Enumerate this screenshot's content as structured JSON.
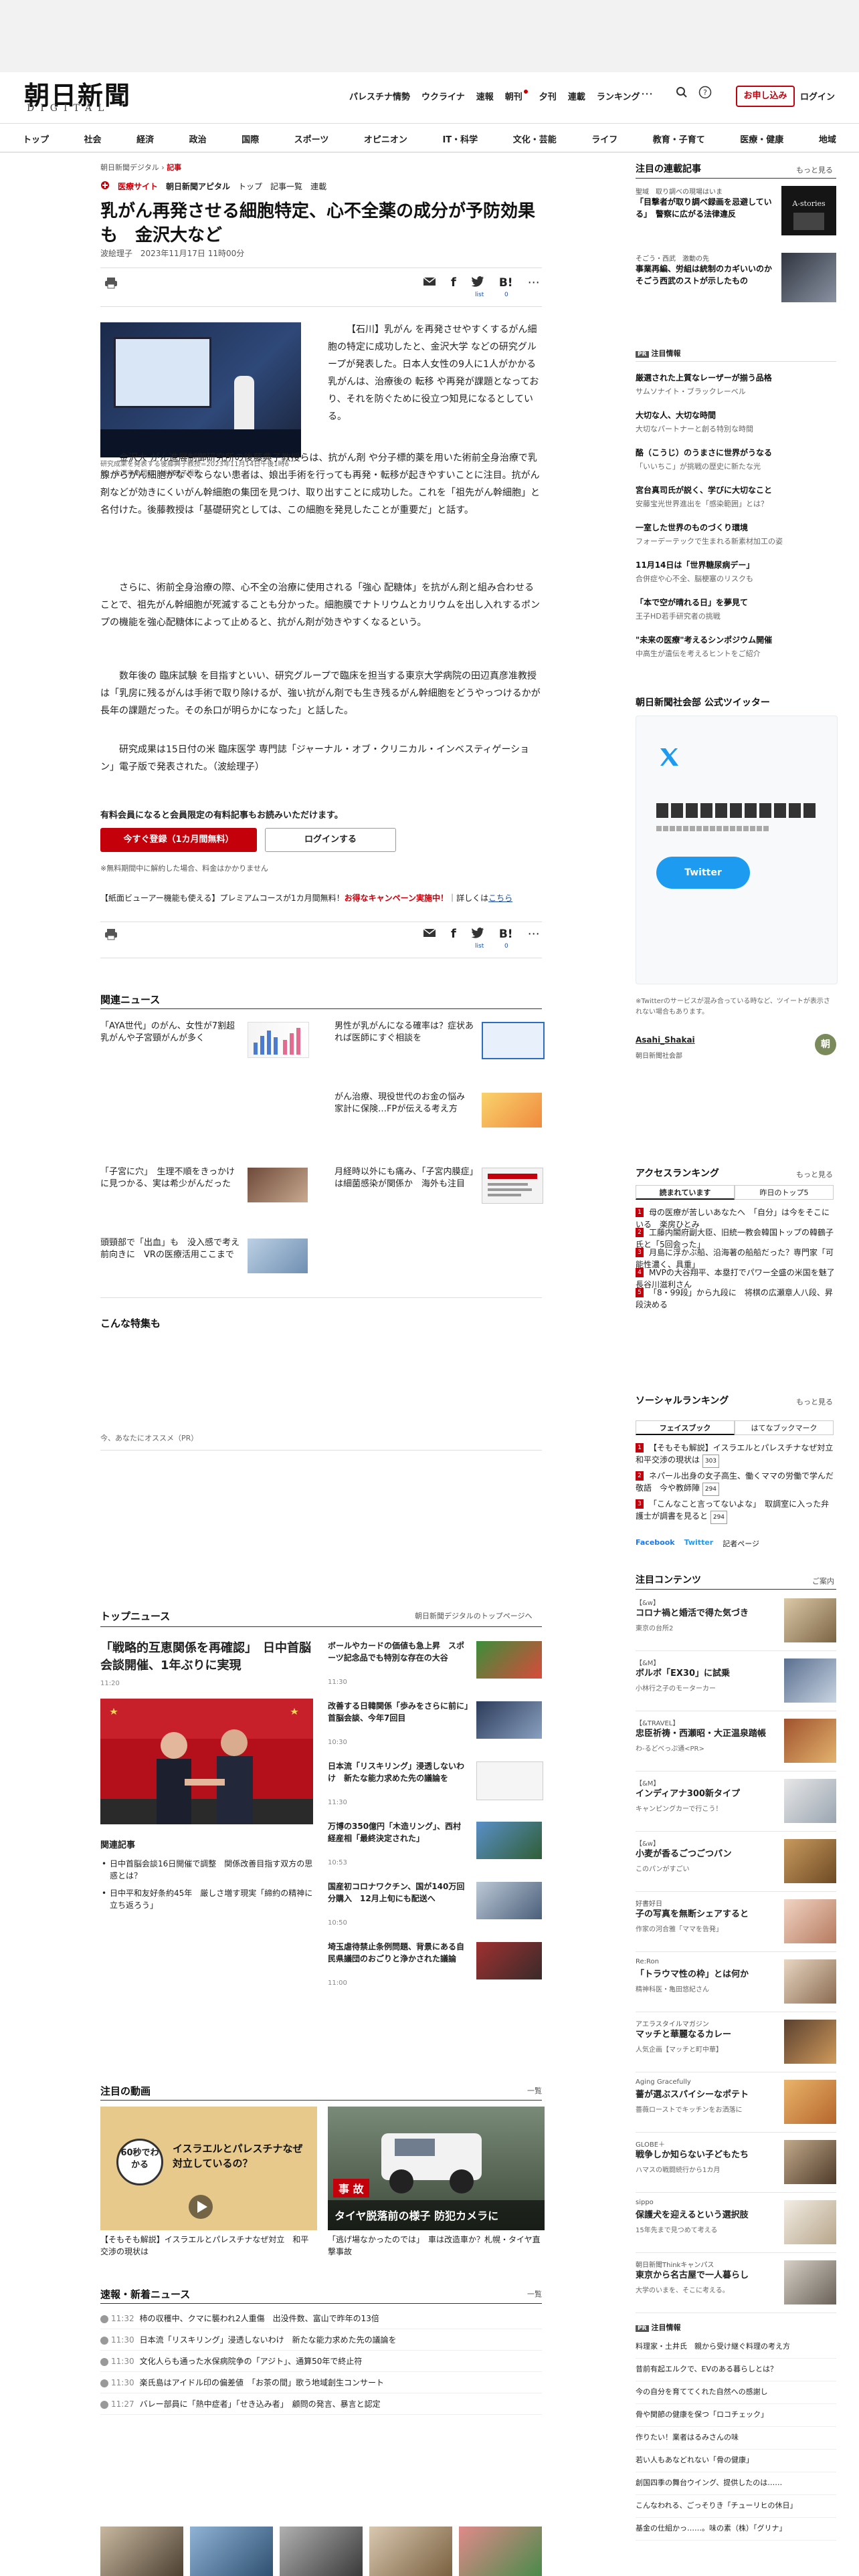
{
  "header": {
    "logo_jp": "朝日新聞",
    "logo_en": "DIGITAL",
    "topnav": [
      "パレスチナ情勢",
      "ウクライナ",
      "速報",
      "朝刊",
      "夕刊",
      "連載",
      "ランキング"
    ],
    "subscribe_label": "お申し込み",
    "login_label": "ログイン",
    "more_dots": "⋯"
  },
  "catnav": [
    "トップ",
    "社会",
    "経済",
    "政治",
    "国際",
    "スポーツ",
    "オピニオン",
    "IT・科学",
    "文化・芸能",
    "ライフ",
    "教育・子育て",
    "医療・健康",
    "地域"
  ],
  "breadcrumb": {
    "site": "朝日新聞デジタル",
    "sep": "›",
    "current": "記事"
  },
  "medical": {
    "tag": "医療サイト",
    "brand": "朝日新聞アピタル",
    "links": [
      "トップ",
      "記事一覧",
      "連載"
    ]
  },
  "article": {
    "title": "乳がん再発させる細胞特定、心不全薬の成分が予防効果も　金沢大など",
    "author": "波絵理子",
    "date": "2023年11月17日 11時00分",
    "share_counts": {
      "hatena_label": "list",
      "hatena_count": "0"
    },
    "caption": "研究成果を発表する後藤典子教授=2023年11月14日午後1時6分、金沢市角間町、波絵理子撮影",
    "paragraphs": [
      "【石川】乳がん を再発させやすくするがん細胞の特定に成功したと、金沢大学 などの研究グループが発表した。日本人女性の9人に1人がかかる乳がんは、治療後の 転移 や再発が課題となっており、それを防ぐために役立つ知見になるとしている。",
      "金沢大 がん進展制御研究所の後藤典子教授らは、抗がん剤 や分子標的薬を用いた術前全身治療で乳腺からがん細胞がなくならない患者は、娘出手術を行っても再発・転移が起きやすいことに注目。抗がん剤などが効きにくいがん幹細胞の集団を見つけ、取り出すことに成功した。これを「祖先がん幹細胞」と名付けた。後藤教授は「基礎研究としては、この細胞を発見したことが重要だ」と話す。",
      "さらに、術前全身治療の際、心不全の治療に使用される「強心 配糖体」を抗がん剤と組み合わせることで、祖先がん幹細胞が死滅することも分かった。細胞膜でナトリウムとカリウムを出し入れするポンプの機能を強心配糖体によって止めると、抗がん剤が効きやすくなるという。",
      "数年後の 臨床試験 を目指すといい、研究グループで臨床を担当する東京大学病院の田辺真彦准教授は「乳房に残るがんは手術で取り除けるが、強い抗がん剤でも生き残るがん幹細胞をどうやっつけるかが長年の課題だった。その糸口が明らかになった」と話した。",
      "研究成果は15日付の米 臨床医学 専門誌「ジャーナル・オブ・クリニカル・インベスティゲーション」電子版で発表された。（波絵理子）"
    ]
  },
  "paywall": {
    "heading": "有料会員になると会員限定の有料記事もお読みいただけます。",
    "register_label": "今すぐ登録（1カ月間無料）",
    "login_label": "ログインする",
    "note": "※無料期間中に解約した場合、料金はかかりません",
    "promo_prefix": "【紙面ビューアー機能も使える】プレミアムコースが1カ月間無料！",
    "promo_red": "お得なキャンペーン実施中！",
    "promo_suffix": "詳しくは",
    "promo_link": "こちら"
  },
  "related": {
    "heading": "関連ニュース",
    "items": [
      "「AYA世代」のがん、女性が7割超　乳がんや子宮頸がんが多く",
      "男性が乳がんになる確率は？症状あれば医師にすぐ相談を",
      "がん治療、現役世代のお金の悩み　家計に保険…FPが伝える考え方",
      "「子宮に穴」　生理不順をきっかけに見つかる、実は希少がんだった",
      "月経時以外にも痛み、「子宮内膜症」は細菌感染が関係か　海外も注目",
      "頭頸部で「出血」も　没入感で考え前向きに　VRの医療活用ここまで"
    ]
  },
  "special": {
    "heading": "こんな特集も",
    "pr_label": "今、あなたにオススメ（PR）"
  },
  "top_news": {
    "heading": "トップニュース",
    "more": "朝日新聞デジタルのトップページへ",
    "main_title": "「戦略的互恵関係を再確認」　日中首脳会談開催、1年ぶりに実現",
    "main_time": "11:20",
    "related_label": "関連記事",
    "related_items": [
      "日中首脳会談16日開催で調整　関係改善目指す双方の思惑とは？",
      "日中平和友好条約45年　厳しさ増す現実「締約の精神に立ち返ろう」"
    ],
    "side_items": [
      {
        "title": "ボールやカードの価値も急上昇　スポーツ記念品でも特別な存在の大谷",
        "time": "11:30"
      },
      {
        "title": "改善する日韓関係「歩みをさらに前に」　首脳会談、今年7回目",
        "time": "10:30"
      },
      {
        "title": "日本流「リスキリング」浸透しないわけ　新たな能力求めた先の議論を",
        "time": "11:30"
      },
      {
        "title": "万博の350億円「木造リング」、西村経産相「最終決定された」",
        "time": "10:53"
      },
      {
        "title": "国産初コロナワクチン、国が140万回分購入　12月上旬にも配送へ",
        "time": "10:50"
      },
      {
        "title": "埼玉虐待禁止条例問題、背景にある自民県議団のおごりと浄かされた議論",
        "time": "11:00"
      }
    ]
  },
  "videos": {
    "heading": "注目の動画",
    "more": "一覧",
    "items": [
      {
        "overlay": "イスラエルとパレスチナなぜ対立しているの？",
        "badge": "60秒でわかる",
        "title": "【そもそも解説】イスラエルとパレスチナなぜ対立　和平交渉の現状は"
      },
      {
        "overlay": "タイヤ脱落前の様子 防犯カメラに",
        "badge": "事 故",
        "title": "「逃げ場なかったのでは」　車は改造車か？札幌・タイヤ直撃事故"
      }
    ]
  },
  "breaking": {
    "heading": "速報・新着ニュース",
    "more": "一覧",
    "items": [
      {
        "time": "11:32",
        "text": "柿の収穫中、クマに襲われ2人重傷　出没件数、富山で昨年の13倍"
      },
      {
        "time": "11:30",
        "text": "日本流「リスキリング」浸透しないわけ　新たな能力求めた先の議論を"
      },
      {
        "time": "11:30",
        "text": "文化人らも通った水保病院争の「アジト」、通算50年で終止符"
      },
      {
        "time": "11:30",
        "text": "楽氏島はアイドル印の偏差値　「お茶の間」歌う地域創生コンサート"
      },
      {
        "time": "11:27",
        "text": "バレー部員に「熱中症者」「せき込み者」　顧問の発言、暴言と認定"
      }
    ]
  },
  "sidebar": {
    "featured_heading": "注目の連載記事",
    "featured_more": "もっと見る",
    "featured": [
      {
        "tag": "聖域　取り調べの現場はいま",
        "title": "「目撃者が取り調べ録画を忌避している」　警察に広がる法律違反"
      },
      {
        "tag": "そごう・西武　激動の先",
        "title": "事業再編、労組は統制のカギいいのか　そごう西武のストが示したもの"
      }
    ],
    "ad_label": "注目情報",
    "pr_items": [
      {
        "b": "厳選された上質なレーザーが揃う品格",
        "s": "サムソナイト・ブラックレーベル"
      },
      {
        "b": "大切な人、大切な時間",
        "s": "大切なパートナーと創る特別な時間"
      },
      {
        "b": "酪（こうじ）のうまさに世界がうなる",
        "s": "「いいちこ」が挑戦の歴史に新たな光"
      },
      {
        "b": "宮台真司氏が説く、学びに大切なこと",
        "s": "安藤宝光世界進出を「感染範囲」とは？"
      },
      {
        "b": "一室した世界のものづくり環境",
        "s": "フォーデーテックで生まれる新素材加工の姿"
      },
      {
        "b": "11月14日は「世界糖尿病デー」",
        "s": "合併症や心不全、脳梗塞のリスクも"
      },
      {
        "b": "「本で空が晴れる日」を夢見て",
        "s": "王子HD若手研究者の挑戦"
      },
      {
        "b": "\"未来の医療\"考えるシンポジウム開催",
        "s": "中高生が遺伝を考えるヒントをご紹介"
      }
    ],
    "twitter_heading": "朝日新聞社会部 公式ツイッター",
    "twitter_button": "Twitter",
    "twitter_note": "※Twitterのサービスが混み合っている時など、ツイートが表示されない場合もあります。",
    "twitter_account": "Asahi_Shakai",
    "twitter_account_sub": "朝日新聞社会部",
    "access_heading": "アクセスランキング",
    "access_more": "もっと見る",
    "access_tabs": [
      "読まれています",
      "昨日のトップ5"
    ],
    "access_items": [
      "母の医療が苦しいあなたへ　「自分」は今をそこにいる　楽房ひとみ",
      "工藤内閣府副大臣、旧統一教会韓国トップの韓鶴子氏と「5回会った」",
      "月島に浮かぶ船、沿海著の船船だった？専門家「可能性濃く、具重」",
      "MVPの大谷翔平、本塁打でパワー全盛の米国を魅了　長谷川滋利さん",
      "「8・99段」から九段に　将棋の広瀬章人八段、昇段決める"
    ],
    "social_heading": "ソーシャルランキング",
    "social_more": "もっと見る",
    "social_tabs": [
      "フェイスブック",
      "はてなブックマーク"
    ],
    "social_items": [
      {
        "t": "【そもそも解説】イスラエルとパレスチナなぜ対立　和平交渉の現状は",
        "c": "303"
      },
      {
        "t": "ネパール出身の女子高生、働くママの労働で学んだ敬語　今や教師陣",
        "c": "294"
      },
      {
        "t": "「こんなこと言ってないよな」　取調室に入った弁護士が調書を見ると",
        "c": "294"
      }
    ],
    "social_footer": [
      "Facebook",
      "Twitter",
      "記者ページ"
    ],
    "contents_heading": "注目コンテンツ",
    "contents_more": "ご案内",
    "contents": [
      {
        "tag": "【&w】",
        "t": "コロナ禍と婚活で得た気づき",
        "s": "東京の台所2"
      },
      {
        "tag": "【&M】",
        "t": "ボルボ「EX30」に試乗",
        "s": "小林行之子のモーターカー"
      },
      {
        "tag": "【&TRAVEL】",
        "t": "忠臣祈祷・西瀬昭・大正温泉踏帳",
        "s": "わ-るどべっぷ通<PR>"
      },
      {
        "tag": "【&M】",
        "t": "インディアナ300新タイプ",
        "s": "キャンピングカーで行こう！"
      },
      {
        "tag": "【&w】",
        "t": "小麦が香るごつごつパン",
        "s": "このパンがすごい"
      },
      {
        "tag": "好書好日",
        "t": "子の写真を無断シェアすると",
        "s": "作家の河合雅「ママを告発」"
      },
      {
        "tag": "Re:Ron",
        "t": "「トラウマ性の枠」とは何か",
        "s": "精神科医・亀田悠紀さん"
      },
      {
        "tag": "アエラスタイルマガジン",
        "t": "マッチと華麗なるカレー",
        "s": "人気企画【マッチと町中華】"
      },
      {
        "tag": "Aging Gracefully",
        "t": "薔が選ぶスパイシーなポテト",
        "s": "薔薇ローストでキッチンをお洒落に"
      },
      {
        "tag": "GLOBE＋",
        "t": "戦争しか知らない子どもたち",
        "s": "ハマスの戦闘続行から1カ月"
      },
      {
        "tag": "sippo",
        "t": "保護犬を迎えるという選択肢",
        "s": "15年先まで見つめて考える"
      },
      {
        "tag": "朝日新聞Thinkキャンパス",
        "t": "東京から名古屋で一人暮らし",
        "s": "大学のいまを、そこに考える。"
      }
    ],
    "topics_heading": "注目情報",
    "topics": [
      "料理家・土井氏　親から受け継ぐ料理の考え方",
      "昔前有起エルクで、EVのある暮らしとは？",
      "今の自分を育ててくれた自然への感謝し",
      "骨や関節の健康を保つ「ロコチェック」",
      "作りたい！業者はるみさんの味",
      "若い人もあなどれない「骨の健康」",
      "創国四季の舞台ウイング、提供したのは……",
      "こんなわれる、ごっそりき「チューリヒの休日」",
      "基金の仕組かっ……。味の素（株）「グリナ」"
    ]
  }
}
